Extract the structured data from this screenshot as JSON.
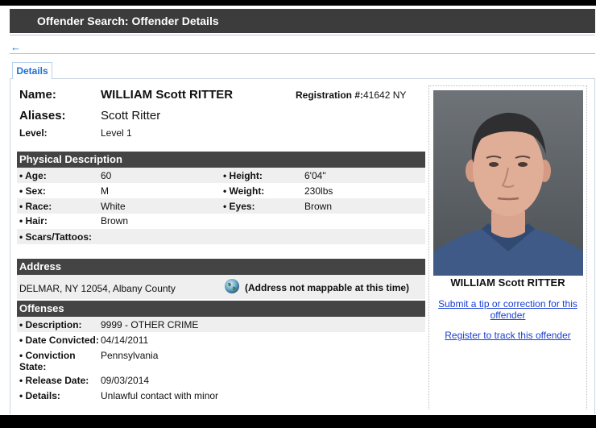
{
  "header": {
    "title": "Offender Search: Offender Details",
    "back_icon": "arrow-left-icon"
  },
  "tabs": {
    "details": "Details"
  },
  "name": {
    "label": "Name:",
    "value": "WILLIAM Scott RITTER"
  },
  "registration": {
    "label": "Registration #:",
    "value": "41642 NY"
  },
  "aliases": {
    "label": "Aliases:",
    "value": "Scott Ritter"
  },
  "level": {
    "label": "Level:",
    "value": "Level 1"
  },
  "physical": {
    "heading": "Physical Description",
    "age": {
      "label": "• Age:",
      "value": "60"
    },
    "height": {
      "label": "• Height:",
      "value": "6'04\""
    },
    "sex": {
      "label": "• Sex:",
      "value": "M"
    },
    "weight": {
      "label": "• Weight:",
      "value": "230lbs"
    },
    "race": {
      "label": "• Race:",
      "value": "White"
    },
    "eyes": {
      "label": "• Eyes:",
      "value": "Brown"
    },
    "hair": {
      "label": "• Hair:",
      "value": "Brown"
    },
    "scars": {
      "label": "• Scars/Tattoos:",
      "value": ""
    }
  },
  "address": {
    "heading": "Address",
    "value": "DELMAR, NY 12054, Albany County",
    "map_note": "(Address not mappable at this time)",
    "globe_icon": "globe-icon"
  },
  "offenses": {
    "heading": "Offenses",
    "description": {
      "label": "• Description:",
      "value": "9999 - OTHER CRIME"
    },
    "date_convicted": {
      "label": "• Date Convicted:",
      "value": "04/14/2011"
    },
    "conviction_state": {
      "label_line1": "• Conviction",
      "label_line2": "State:",
      "value": "Pennsylvania"
    },
    "release_date": {
      "label": "• Release Date:",
      "value": "09/03/2014"
    },
    "details": {
      "label": "• Details:",
      "value": "Unlawful contact with minor"
    }
  },
  "sidebar": {
    "photo_caption": "WILLIAM Scott RITTER",
    "tip_link_line1": "Submit a tip or correction for this",
    "tip_link_line2": "offender",
    "register_link": "Register to track this offender"
  },
  "colors": {
    "header_bg": "#3c3c3c",
    "section_bg": "#444444",
    "link": "#1a3fd0",
    "accent": "#1a6fd6"
  }
}
